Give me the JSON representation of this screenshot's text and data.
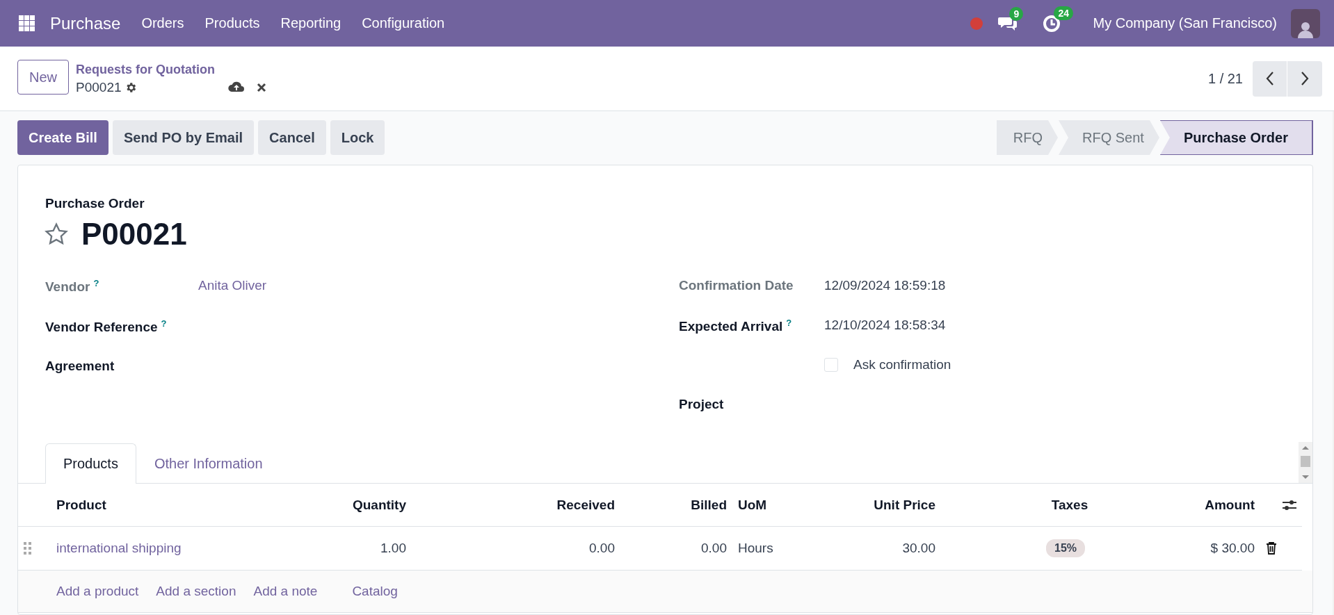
{
  "navbar": {
    "app_name": "Purchase",
    "menu": [
      "Orders",
      "Products",
      "Reporting",
      "Configuration"
    ],
    "systray": [
      {
        "kind": "dot",
        "color": "#d23f3a"
      },
      {
        "kind": "chat",
        "count": "9"
      },
      {
        "kind": "activity",
        "count": "24"
      }
    ],
    "company": "My Company (San Francisco)"
  },
  "control_panel": {
    "new_button": "New",
    "breadcrumb": "Requests for Quotation",
    "record_name": "P00021",
    "pager": "1 / 21"
  },
  "actions": [
    {
      "label": "Create Bill",
      "primary": true
    },
    {
      "label": "Send PO by Email",
      "primary": false
    },
    {
      "label": "Cancel",
      "primary": false
    },
    {
      "label": "Lock",
      "primary": false
    }
  ],
  "status_steps": [
    {
      "label": "RFQ",
      "selected": false
    },
    {
      "label": "RFQ Sent",
      "selected": false
    },
    {
      "label": "Purchase Order",
      "selected": true
    }
  ],
  "form": {
    "title_label": "Purchase Order",
    "title": "P00021",
    "favorite": false,
    "left_fields": [
      {
        "label": "Vendor",
        "help": "?",
        "readonly": true,
        "kind": "link",
        "value": "Anita Oliver"
      },
      {
        "label": "Vendor Reference",
        "help": "?",
        "readonly": false,
        "kind": "text"
      },
      {
        "label": "Agreement",
        "readonly": false,
        "kind": "text"
      }
    ],
    "right_fields": [
      {
        "label": "Confirmation Date",
        "readonly": true,
        "kind": "text",
        "value": "12/09/2024 18:59:18"
      },
      {
        "label": "Expected Arrival",
        "help": "?",
        "readonly": false,
        "kind": "text",
        "value": "12/10/2024 18:58:34"
      },
      {
        "kind": "checkbox",
        "value": "Ask confirmation",
        "checked": false
      },
      {
        "label": "Project",
        "readonly": false,
        "kind": "text"
      }
    ]
  },
  "tabs": [
    {
      "label": "Products",
      "selected": true
    },
    {
      "label": "Other Information",
      "selected": false
    }
  ],
  "table": {
    "columns": [
      "Product",
      "Quantity",
      "Received",
      "Billed",
      "UoM",
      "Unit Price",
      "Taxes",
      "Amount"
    ],
    "rows": [
      {
        "cells": [
          {
            "kind": "link",
            "text": "international shipping"
          },
          {
            "kind": "text",
            "text": "1.00"
          },
          {
            "kind": "text",
            "text": "0.00"
          },
          {
            "kind": "text",
            "text": "0.00"
          },
          {
            "kind": "text",
            "text": "Hours"
          },
          {
            "kind": "text",
            "text": "30.00"
          },
          {
            "kind": "badge",
            "text": "15%"
          },
          {
            "kind": "text",
            "text": "$ 30.00"
          }
        ]
      }
    ],
    "add_links": [
      "Add a product",
      "Add a section",
      "Add a note",
      "Catalog"
    ]
  }
}
